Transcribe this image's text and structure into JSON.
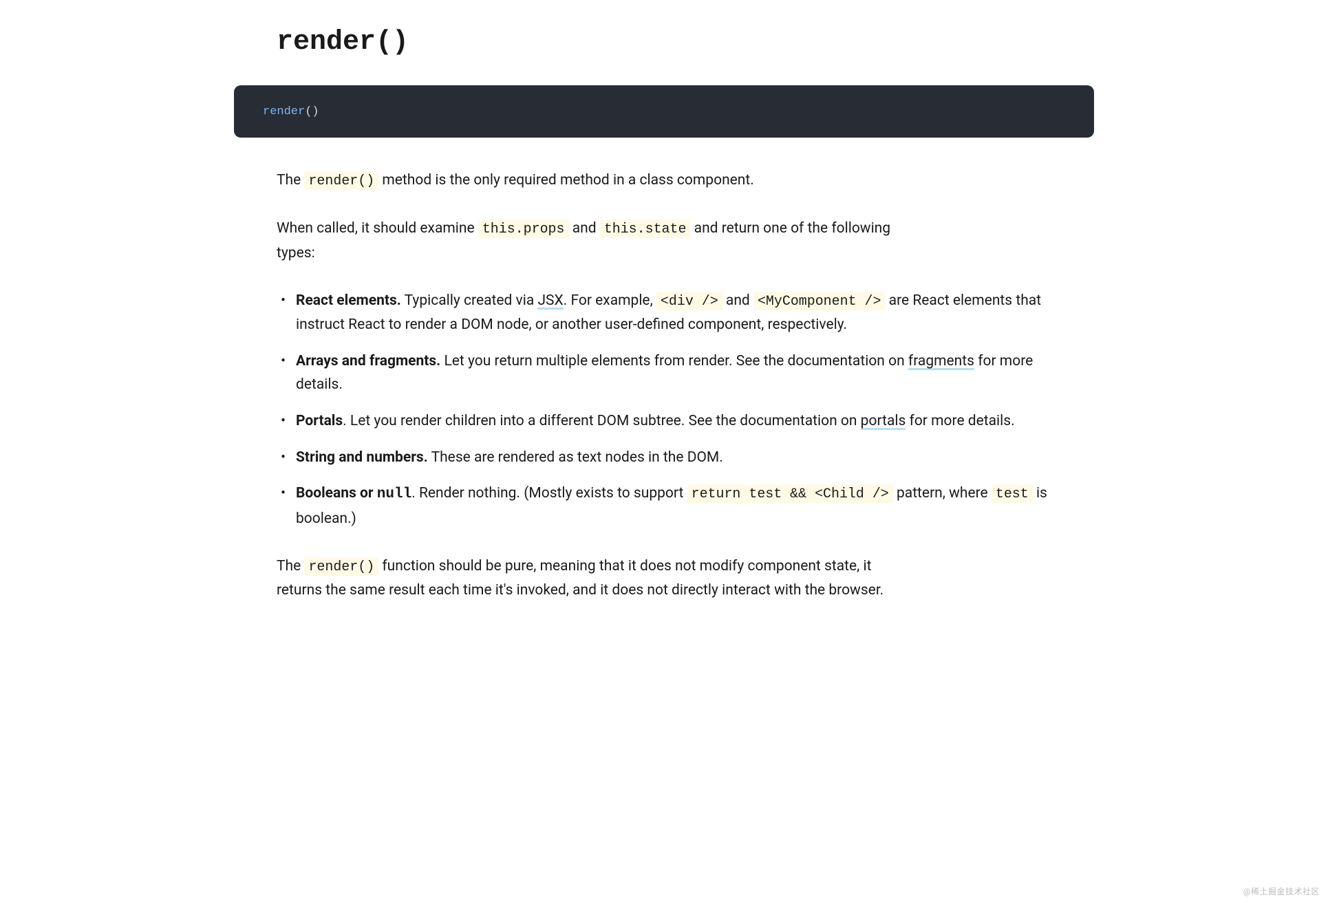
{
  "title": "render()",
  "code_block": {
    "fn_name": "render",
    "parens": "()"
  },
  "intro": {
    "pre": "The ",
    "code": "render()",
    "post": " method is the only required method in a class component."
  },
  "when_called": {
    "a": "When called, it should examine ",
    "code_props": "this.props",
    "b": " and ",
    "code_state": "this.state",
    "c": " and return one of the following types:"
  },
  "items": {
    "react_elements": {
      "title": "React elements.",
      "t1": " Typically created via ",
      "link_jsx": "JSX",
      "t2": ". For example, ",
      "code_div": "<div />",
      "t3": " and ",
      "code_mycomp": "<MyComponent />",
      "t4": " are React elements that instruct React to render a DOM node, or another user-defined component, respectively."
    },
    "arrays": {
      "title": "Arrays and fragments.",
      "t1": " Let you return multiple elements from render. See the documentation on ",
      "link": "fragments",
      "t2": " for more details."
    },
    "portals": {
      "title": "Portals",
      "t1": ". Let you render children into a different DOM subtree. See the documentation on ",
      "link": "portals",
      "t2": " for more details."
    },
    "strings": {
      "title": "String and numbers.",
      "t1": " These are rendered as text nodes in the DOM."
    },
    "booleans": {
      "title_a": "Booleans or ",
      "title_code": "null",
      "t1": ". Render nothing. (Mostly exists to support ",
      "code_return": "return test && <Child />",
      "t2": " pattern, where ",
      "code_test": "test",
      "t3": " is boolean.)"
    }
  },
  "pure_para": {
    "a": "The ",
    "code": "render()",
    "b": " function should be pure, meaning that it does not modify component state, it returns the same result each time it's invoked, and it does not directly interact with the browser."
  },
  "watermark": "@稀土掘金技术社区"
}
